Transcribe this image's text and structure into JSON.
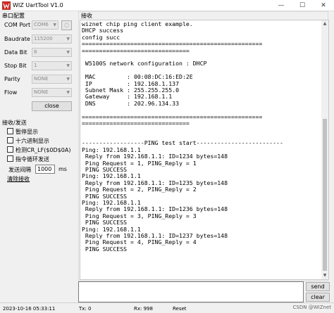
{
  "window": {
    "title": "WIZ UartTool V1.0",
    "minimize": "—",
    "maximize": "☐",
    "close": "✕"
  },
  "serial": {
    "group_title": "串口配置",
    "com_port": {
      "label": "COM Port",
      "value": "COM6"
    },
    "baudrate": {
      "label": "Baudrate",
      "value": "115200"
    },
    "data_bit": {
      "label": "Data Bit",
      "value": "8"
    },
    "stop_bit": {
      "label": "Stop Bit",
      "value": "1"
    },
    "parity": {
      "label": "Parity",
      "value": "NONE"
    },
    "flow": {
      "label": "Flow",
      "value": "NONE"
    },
    "refresh_symbol": "◌",
    "close_button": "close"
  },
  "rxtx": {
    "group_title": "接收/发送",
    "pause_display": "暂停显示",
    "hex_display": "十六进制显示",
    "check_crlf": "检测CR_LF($0D$0A)",
    "loop_send": "指令循环发送",
    "interval_label": "发送间隔",
    "interval_value": "1000",
    "interval_unit": "ms",
    "clear_receive": "清除接收"
  },
  "receive": {
    "title": "接收",
    "text": "wiznet chip ping client example.\nDHCP success\nconfig succ\n====================================================\n===============================\n\n W5100S network configuration : DHCP\n\n MAC         : 00:08:DC:16:ED:2E\n IP          : 192.168.1.137\n Subnet Mask : 255.255.255.0\n Gateway     : 192.168.1.1\n DNS         : 202.96.134.33\n\n====================================================\n===============================\n\n\n------------------PING test start-------------------------\nPing: 192.168.1.1\n Reply from 192.168.1.1: ID=1234 bytes=148\n Ping Request = 1, PING_Reply = 1\n PING SUCCESS\nPing: 192.168.1.1\n Reply from 192.168.1.1: ID=1235 bytes=148\n Ping Request = 2, PING_Reply = 2\n PING SUCCESS\nPing: 192.168.1.1\n Reply from 192.168.1.1: ID=1236 bytes=148\n Ping Request = 3, PING_Reply = 3\n PING SUCCESS\nPing: 192.168.1.1\n Reply from 192.168.1.1: ID=1237 bytes=148\n Ping Request = 4, PING_Reply = 4\n PING SUCCESS"
  },
  "send": {
    "send_button": "send",
    "clear_button": "clear",
    "value": ""
  },
  "status": {
    "time": "2023-10-16 05:33:11",
    "tx": "Tx: 0",
    "rx": "Rx: 998",
    "reset": "Reset"
  },
  "watermark": "CSDN @WIZnet"
}
